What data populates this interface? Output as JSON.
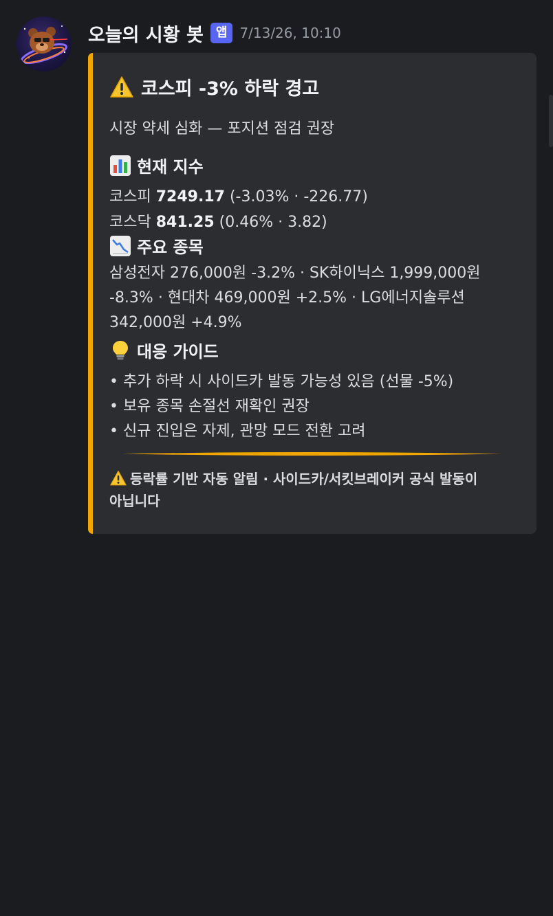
{
  "message": {
    "bot_name": "오늘의 시황 봇",
    "app_badge": "앱",
    "timestamp": "7/13/26, 10:10",
    "avatar_icon": "bear-avatar-icon"
  },
  "embed": {
    "accent_color": "#f0a500",
    "title_icon": "warning-icon",
    "title": "코스피 -3% 하락 경고",
    "description": "시장 약세 심화 — 포지션 점검 권장",
    "index_section": {
      "icon": "bar-chart-icon",
      "title": "현재 지수",
      "kospi_label": "코스피",
      "kospi_value": "7249.17",
      "kospi_change": "(-3.03% · -226.77)",
      "kosdaq_label": "코스닥",
      "kosdaq_value": "841.25",
      "kosdaq_change": "(0.46% · 3.82)"
    },
    "stocks_section": {
      "icon": "chart-decreasing-icon",
      "title": "주요 종목",
      "text": "삼성전자 276,000원 -3.2% · SK하이닉스 1,999,000원 -8.3% · 현대차 469,000원 +2.5% · LG에너지솔루션 342,000원 +4.9%"
    },
    "guide_section": {
      "icon": "light-bulb-icon",
      "title": "대응 가이드",
      "items": [
        "• 추가 하락 시 사이드카 발동 가능성 있음 (선물 -5%)",
        "• 보유 종목 손절선 재확인 권장",
        "• 신규 진입은 자제, 관망 모드 전환 고려"
      ]
    },
    "footer_icon": "warning-icon",
    "footer": "등락률 기반 자동 알림 · 사이드카/서킷브레이커 공식 발동이 아닙니다"
  }
}
